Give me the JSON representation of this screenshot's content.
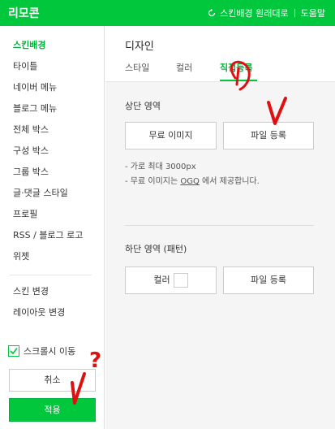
{
  "header": {
    "title": "리모콘",
    "reset_label": "스킨배경 원래대로",
    "help_label": "도움말"
  },
  "sidebar": {
    "items": [
      {
        "label": "스킨배경"
      },
      {
        "label": "타이틀"
      },
      {
        "label": "네이버 메뉴"
      },
      {
        "label": "블로그 메뉴"
      },
      {
        "label": "전체 박스"
      },
      {
        "label": "구성 박스"
      },
      {
        "label": "그룹 박스"
      },
      {
        "label": "글·댓글 스타일"
      },
      {
        "label": "프로필"
      },
      {
        "label": "RSS / 블로그 로고"
      },
      {
        "label": "위젯"
      }
    ],
    "secondary": [
      {
        "label": "스킨 변경"
      },
      {
        "label": "레이아웃 변경"
      }
    ],
    "scroll_follow_label": "스크롤시 이동",
    "cancel_label": "취소",
    "apply_label": "적용"
  },
  "main": {
    "title": "디자인",
    "tabs": [
      {
        "label": "스타일"
      },
      {
        "label": "컬러"
      },
      {
        "label": "직접등록"
      }
    ],
    "top_section": {
      "title": "상단 영역",
      "free_image_label": "무료 이미지",
      "file_upload_label": "파일 등록",
      "note_max_width": "- 가로 최대 3000px",
      "note_free_prefix": "- 무료 이미지는 ",
      "note_free_link": "OGQ",
      "note_free_suffix": " 에서 제공합니다."
    },
    "bottom_section": {
      "title": "하단 영역 (패턴)",
      "color_label": "컬러",
      "file_upload_label": "파일 등록"
    }
  },
  "annotations": {
    "question_mark": "?"
  },
  "colors": {
    "brand_green": "#00c73c",
    "annotation_red": "#e01010"
  }
}
